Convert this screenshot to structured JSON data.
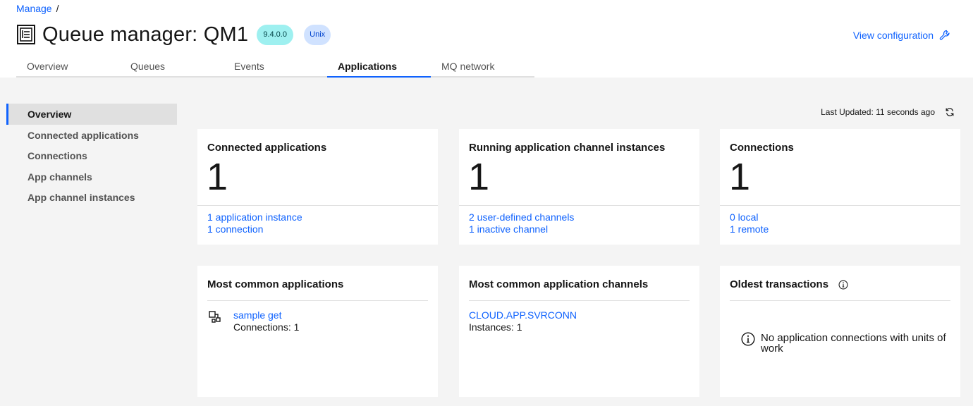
{
  "breadcrumb": {
    "parent": "Manage",
    "separator": "/"
  },
  "header": {
    "title": "Queue manager: QM1",
    "version_tag": "9.4.0.0",
    "os_tag": "Unix",
    "view_config": "View configuration",
    "icon": "queue-manager-icon"
  },
  "tabs": [
    {
      "label": "Overview",
      "active": false
    },
    {
      "label": "Queues",
      "active": false
    },
    {
      "label": "Events",
      "active": false
    },
    {
      "label": "Applications",
      "active": true
    },
    {
      "label": "MQ network",
      "active": false
    }
  ],
  "sidenav": [
    {
      "label": "Overview",
      "active": true
    },
    {
      "label": "Connected applications",
      "active": false
    },
    {
      "label": "Connections",
      "active": false
    },
    {
      "label": "App channels",
      "active": false
    },
    {
      "label": "App channel instances",
      "active": false
    }
  ],
  "last_updated": "Last Updated: 11 seconds ago",
  "cards": {
    "connected_apps": {
      "title": "Connected applications",
      "value": "1",
      "links": [
        "1 application instance",
        "1 connection"
      ]
    },
    "running_channels": {
      "title": "Running application channel instances",
      "value": "1",
      "links": [
        "2 user-defined channels",
        "1 inactive channel"
      ]
    },
    "connections": {
      "title": "Connections",
      "value": "1",
      "links": [
        "0 local",
        "1 remote"
      ]
    }
  },
  "common_apps": {
    "title": "Most common applications",
    "items": [
      {
        "name": "sample get",
        "detail": "Connections: 1"
      }
    ]
  },
  "common_channels": {
    "title": "Most common application channels",
    "items": [
      {
        "name": "CLOUD.APP.SVRCONN",
        "detail": "Instances: 1"
      }
    ]
  },
  "oldest_transactions": {
    "title": "Oldest transactions",
    "empty_message": "No application connections with units of work"
  },
  "colors": {
    "link": "#0f62fe",
    "accent": "#0f62fe",
    "version_tag_bg": "#9ef0f0",
    "os_tag_bg": "#d0e2ff",
    "page_bg": "#f4f4f4"
  }
}
